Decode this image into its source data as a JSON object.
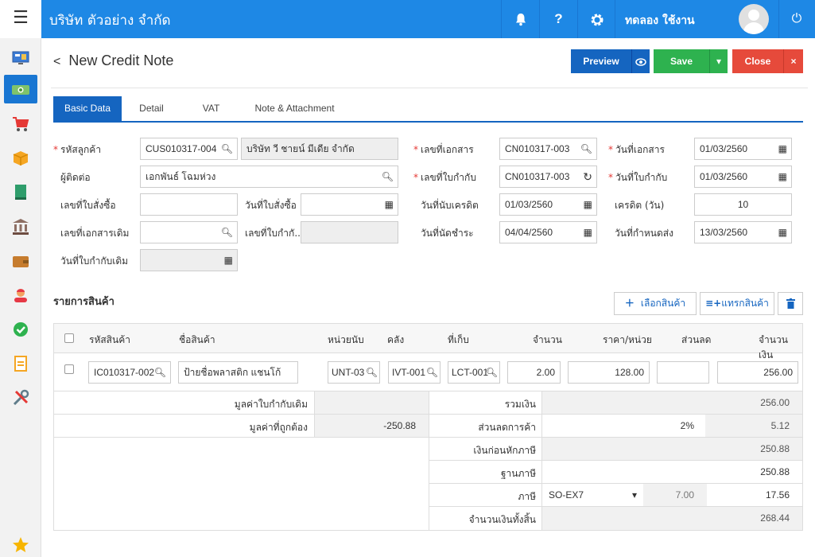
{
  "topbar": {
    "company": "บริษัท ตัวอย่าง จำกัด",
    "user_name": "ทดลอง ใช้งาน"
  },
  "page": {
    "title": "New Credit Note",
    "buttons": {
      "preview": "Preview",
      "save": "Save",
      "close": "Close"
    }
  },
  "tabs": [
    "Basic Data",
    "Detail",
    "VAT",
    "Note & Attachment"
  ],
  "form": {
    "customer_code_label": "รหัสลูกค้า",
    "customer_code": "CUS010317-004",
    "customer_name": "บริษัท วี ชายน์ มีเดีย จำกัด",
    "contact_label": "ผู้ติดต่อ",
    "contact": "เอกพันธ์ โฉมห่วง",
    "po_number_label": "เลขที่ใบสั่งซื้อ",
    "po_number": "",
    "po_date_label": "วันที่ใบสั่งซื้อ",
    "po_date": "",
    "orig_doc_label": "เลขที่เอกสารเดิม",
    "orig_doc": "",
    "orig_tax_label": "เลขที่ใบกำกั...",
    "orig_tax": "",
    "orig_tax_date_label": "วันที่ใบกำกับเดิม",
    "orig_tax_date": "",
    "doc_no_label": "เลขที่เอกสาร",
    "doc_no": "CN010317-003",
    "tax_no_label": "เลขที่ใบกำกับ",
    "tax_no": "CN010317-003",
    "credit_start_label": "วันที่นับเครดิต",
    "credit_start": "01/03/2560",
    "due_date_label": "วันที่นัดชำระ",
    "due_date": "04/04/2560",
    "doc_date_label": "วันที่เอกสาร",
    "doc_date": "01/03/2560",
    "tax_date_label": "วันที่ใบกำกับ",
    "tax_date": "01/03/2560",
    "credit_days_label": "เครดิต (วัน)",
    "credit_days": "10",
    "delivery_date_label": "วันที่กำหนดส่ง",
    "delivery_date": "13/03/2560"
  },
  "products": {
    "title": "รายการสินค้า",
    "select_btn": "เลือกสินค้า",
    "insert_btn": "แทรกสินค้า",
    "headers": [
      "รหัสสินค้า",
      "ชื่อสินค้า",
      "หน่วยนับ",
      "คลัง",
      "ที่เก็บ",
      "จำนวน",
      "ราคา/หน่วย",
      "ส่วนลด",
      "จำนวนเงิน"
    ],
    "row": {
      "code": "IC010317-002",
      "name": "ป้ายชื่อพลาสติก แชนโก้",
      "unit": "UNT-03",
      "warehouse": "IVT-001",
      "location": "LCT-001",
      "qty": "2.00",
      "price": "128.00",
      "discount": "",
      "amount": "256.00"
    }
  },
  "summary": {
    "orig_value_label": "มูลค่าใบกำกับเดิม",
    "orig_value": "",
    "correct_value_label": "มูลค่าที่ถูกต้อง",
    "correct_value": "-250.88",
    "total_label": "รวมเงิน",
    "total": "256.00",
    "discount_label": "ส่วนลดการค้า",
    "discount_pct": "2%",
    "discount": "5.12",
    "before_tax_label": "เงินก่อนหักภาษี",
    "before_tax": "250.88",
    "tax_base_label": "ฐานภาษี",
    "tax_base": "250.88",
    "tax_label": "ภาษี",
    "tax_code": "SO-EX7",
    "tax_rate": "7.00",
    "tax": "17.56",
    "grand_total_label": "จำนวนเงินทั้งสิ้น",
    "grand_total": "268.44"
  },
  "colors": {
    "primary": "#1e88e5",
    "save": "#2eb24f",
    "close": "#e64a3b",
    "tab_active": "#1565c0"
  }
}
